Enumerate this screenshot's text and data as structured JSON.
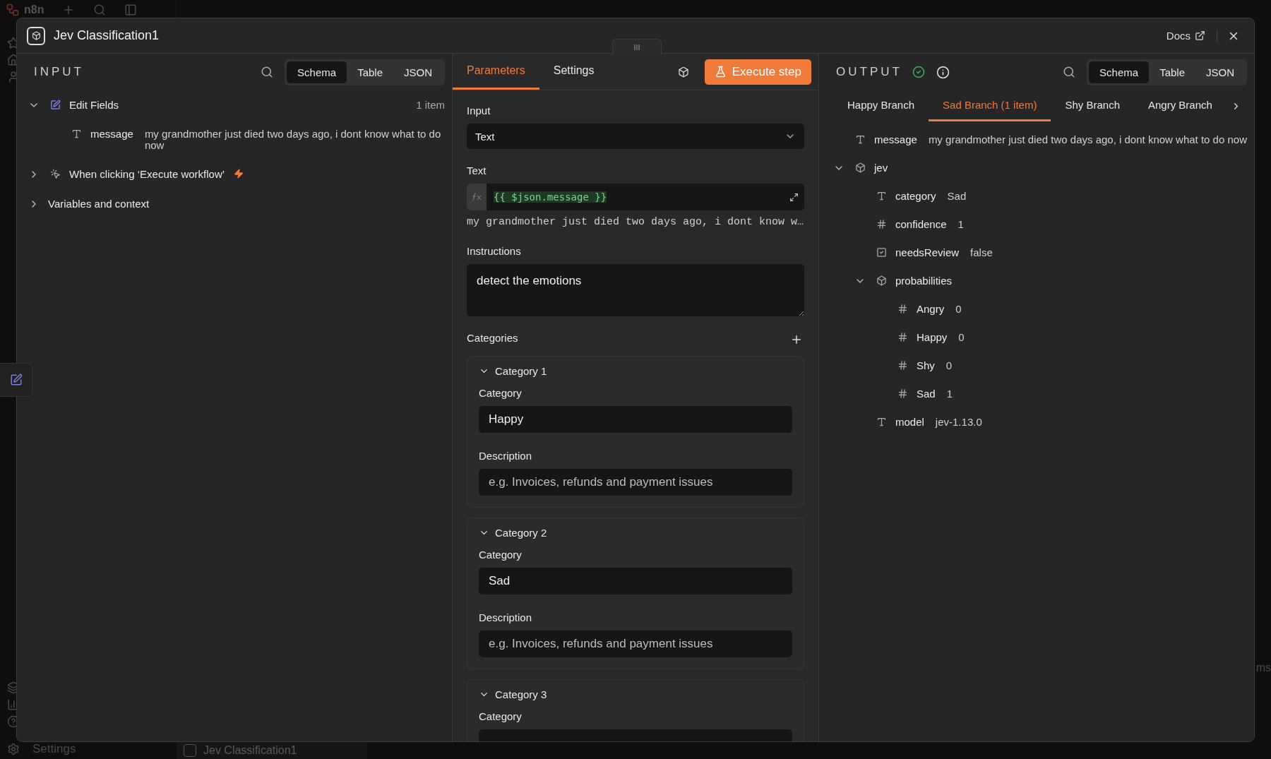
{
  "background": {
    "app_name": "n8n",
    "sidebar_footer": "Settings",
    "open_tab": "Jev Classification1",
    "edge_text": "ms"
  },
  "window": {
    "title": "Jev Classification1",
    "docs_link": "Docs"
  },
  "input_panel": {
    "heading": "INPUT",
    "views": [
      {
        "label": "Schema",
        "selected": true
      },
      {
        "label": "Table",
        "selected": false
      },
      {
        "label": "JSON",
        "selected": false
      }
    ],
    "tree": [
      {
        "kind": "node",
        "label": "Edit Fields",
        "count": "1 item",
        "expanded": true,
        "children": [
          {
            "kind": "string",
            "key": "message",
            "value": "my grandmother just died two days ago, i dont know what to do now"
          }
        ]
      },
      {
        "kind": "trigger",
        "label": "When clicking ‘Execute workflow’",
        "expanded": false
      },
      {
        "kind": "section",
        "label": "Variables and context",
        "expanded": false
      }
    ]
  },
  "parameters_panel": {
    "tabs": [
      {
        "label": "Parameters",
        "selected": true
      },
      {
        "label": "Settings",
        "selected": false
      }
    ],
    "execute_button": "Execute step",
    "input": {
      "label": "Input",
      "value": "Text"
    },
    "text": {
      "label": "Text",
      "expression": "{{ $json.message }}",
      "preview": "my grandmother just died two days ago, i dont know w…"
    },
    "instructions": {
      "label": "Instructions",
      "value": "detect the emotions"
    },
    "categories": {
      "label": "Categories",
      "items": [
        {
          "title": "Category 1",
          "expanded": true,
          "category_label": "Category",
          "value": "Happy",
          "description_label": "Description",
          "description_placeholder": "e.g. Invoices, refunds and payment issues"
        },
        {
          "title": "Category 2",
          "expanded": true,
          "category_label": "Category",
          "value": "Sad",
          "description_label": "Description",
          "description_placeholder": "e.g. Invoices, refunds and payment issues"
        },
        {
          "title": "Category 3",
          "expanded": true,
          "category_label": "Category"
        }
      ]
    }
  },
  "output_panel": {
    "heading": "OUTPUT",
    "success": true,
    "views": [
      {
        "label": "Schema",
        "selected": true
      },
      {
        "label": "Table",
        "selected": false
      },
      {
        "label": "JSON",
        "selected": false
      }
    ],
    "branches": [
      {
        "label": "Happy Branch",
        "selected": false
      },
      {
        "label": "Sad Branch (1 item)",
        "selected": true
      },
      {
        "label": "Shy Branch",
        "selected": false
      },
      {
        "label": "Angry Branch",
        "selected": false
      }
    ],
    "tree": [
      {
        "kind": "string",
        "key": "message",
        "value": "my grandmother just died two days ago, i dont know what to do now"
      },
      {
        "kind": "object",
        "key": "jev",
        "expanded": true,
        "children": [
          {
            "kind": "string",
            "key": "category",
            "value": "Sad"
          },
          {
            "kind": "number",
            "key": "confidence",
            "value": "1"
          },
          {
            "kind": "boolean",
            "key": "needsReview",
            "value": "false"
          },
          {
            "kind": "object",
            "key": "probabilities",
            "expanded": true,
            "children": [
              {
                "kind": "number",
                "key": "Angry",
                "value": "0"
              },
              {
                "kind": "number",
                "key": "Happy",
                "value": "0"
              },
              {
                "kind": "number",
                "key": "Shy",
                "value": "0"
              },
              {
                "kind": "number",
                "key": "Sad",
                "value": "1"
              }
            ]
          },
          {
            "kind": "string",
            "key": "model",
            "value": "jev-1.13.0"
          }
        ]
      }
    ]
  }
}
